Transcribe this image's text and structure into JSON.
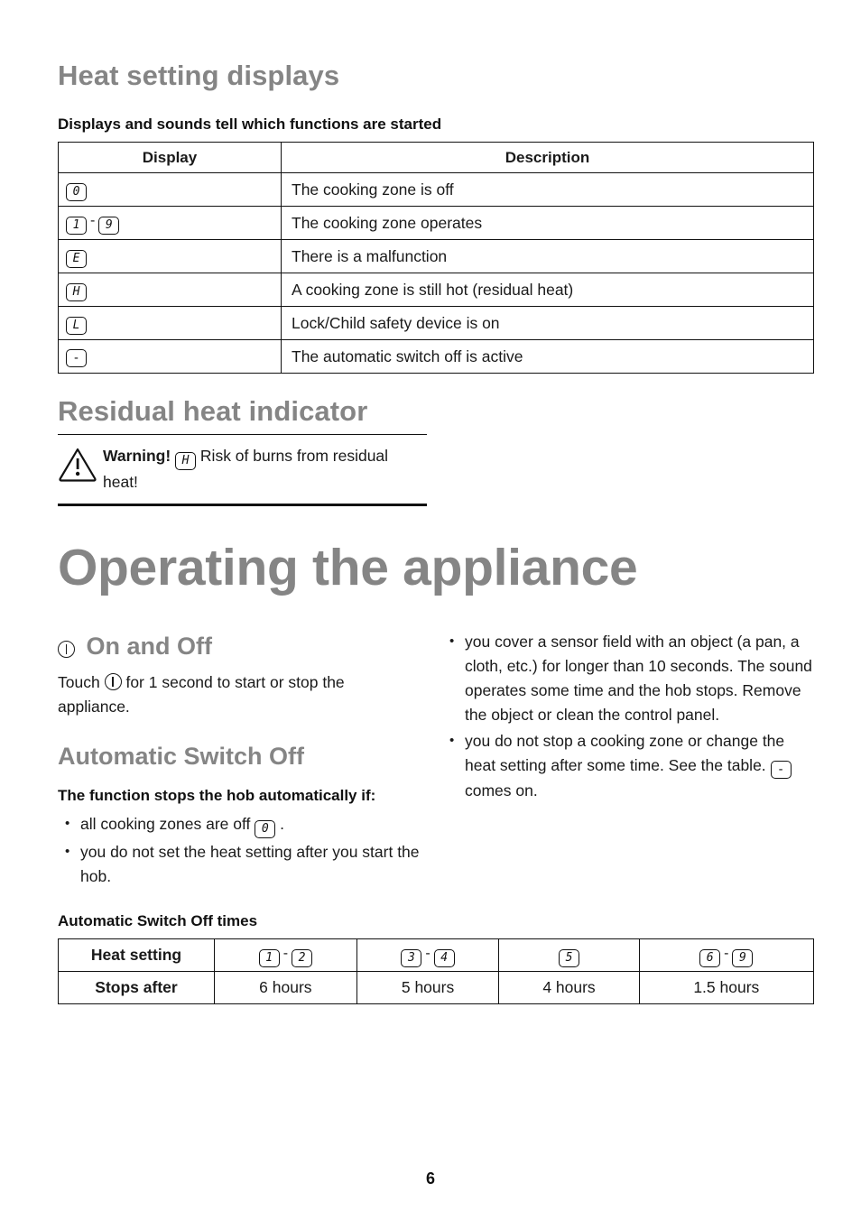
{
  "document": {
    "page_number": "6",
    "heading_color": "#858585",
    "text_color": "#1a1a1a"
  },
  "section_heat_setting": {
    "title": "Heat setting displays",
    "subtitle": "Displays and sounds tell which functions are started",
    "table": {
      "headers": [
        "Display",
        "Description"
      ],
      "rows": [
        {
          "display": [
            "0"
          ],
          "description": "The cooking zone is off"
        },
        {
          "display": [
            "1",
            "9"
          ],
          "description": "The cooking zone operates"
        },
        {
          "display": [
            "E"
          ],
          "description": "There is a malfunction"
        },
        {
          "display": [
            "H"
          ],
          "description": "A cooking zone is still hot (residual heat)"
        },
        {
          "display": [
            "L"
          ],
          "description": "Lock/Child safety device is on"
        },
        {
          "display": [
            "-"
          ],
          "description": "The automatic switch off is active"
        }
      ]
    }
  },
  "section_residual_heat": {
    "title": "Residual heat indicator",
    "warning": {
      "icon": "warning-triangle-icon",
      "label": "Warning!",
      "symbol": "H",
      "text_after_symbol": "Risk of burns from residual heat!"
    }
  },
  "section_operating": {
    "title": "Operating the appliance",
    "on_and_off": {
      "icon": "power-icon",
      "title": "On and Off",
      "body_before": "Touch",
      "body_after": "for 1 second to start or stop the appliance."
    },
    "automatic_switch_off": {
      "title": "Automatic Switch Off",
      "lead": "The function stops the hob automatically if:",
      "bullets_left": [
        {
          "text_before": "all cooking zones are off",
          "symbol": "0",
          "text_after": "."
        },
        {
          "text_before": "you do not set the heat setting after you start the hob.",
          "symbol": "",
          "text_after": ""
        }
      ],
      "bullets_right": [
        {
          "text_before": "you cover a sensor field with an object (a pan, a cloth, etc.) for longer than 10 seconds. The sound operates some time and the hob stops. Remove the object or clean the control panel.",
          "symbol": "",
          "text_after": ""
        },
        {
          "text_before": "you do not stop a cooking zone or change the heat setting after some time. See the table.",
          "symbol": "-",
          "text_after": "comes on."
        }
      ]
    },
    "switch_off_times": {
      "title": "Automatic Switch Off times",
      "row_headers": [
        "Heat setting",
        "Stops after"
      ],
      "heat_settings": [
        [
          "1",
          "2"
        ],
        [
          "3",
          "4"
        ],
        [
          "5"
        ],
        [
          "6",
          "9"
        ]
      ],
      "stops_after": [
        "6 hours",
        "5 hours",
        "4 hours",
        "1.5 hours"
      ]
    }
  }
}
